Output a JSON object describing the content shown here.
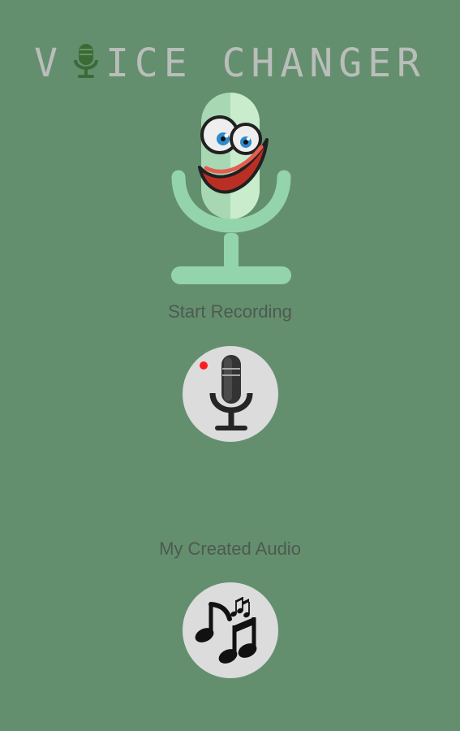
{
  "app": {
    "title_start": "V",
    "title_end": "ICE CHANGER",
    "title_mic_icon": "microphone-letter-o-icon",
    "mascot_icon": "smiling-microphone-mascot-icon",
    "background_color": "#648f6e",
    "text_color": "#4d5a51",
    "button_color": "#dcdcdc"
  },
  "actions": {
    "start_recording": {
      "label": "Start Recording",
      "icon": "record-microphone-icon",
      "indicator_color": "#ff0000"
    },
    "my_created_audio": {
      "label": "My Created Audio",
      "icon": "music-notes-icon"
    }
  }
}
